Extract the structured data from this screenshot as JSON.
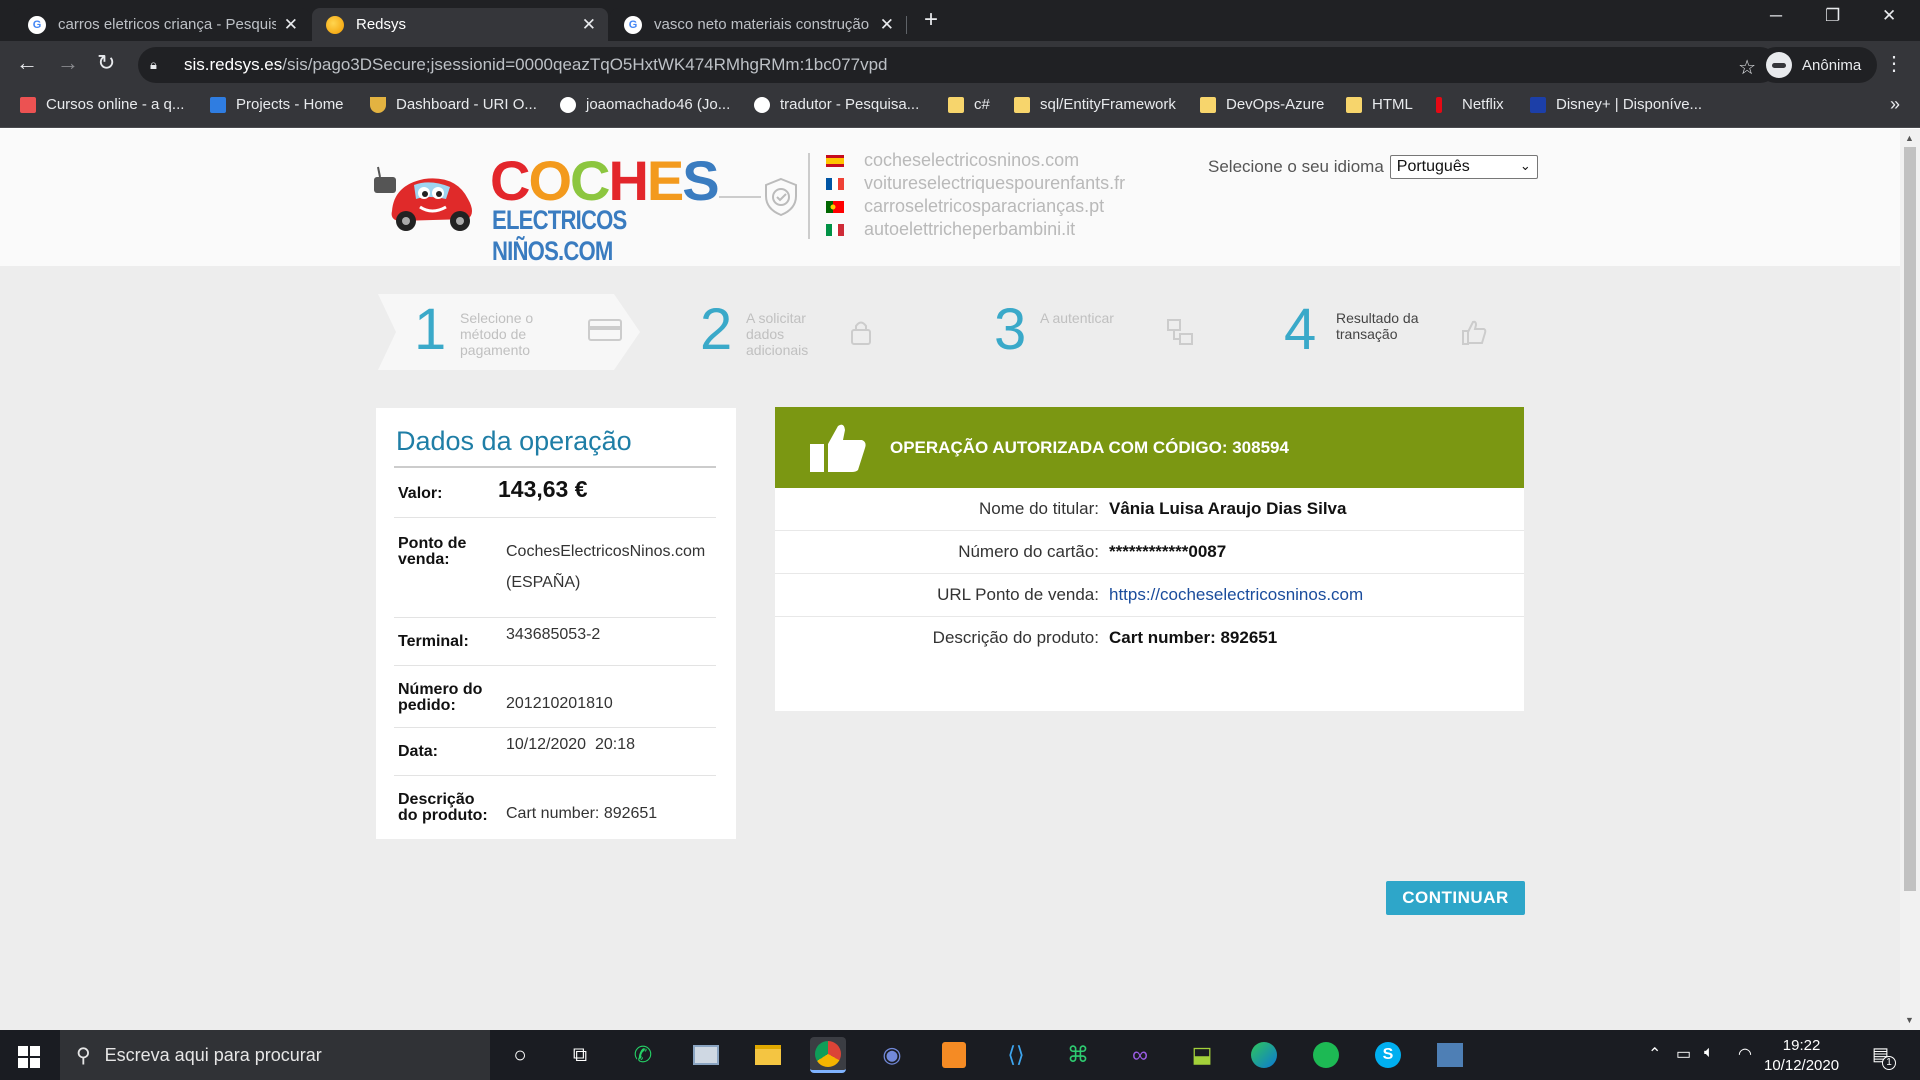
{
  "browser": {
    "tabs": [
      {
        "title": "carros eletricos criança - Pesquisa",
        "favicon": "google-icon",
        "active": false
      },
      {
        "title": "Redsys",
        "favicon": "redsys-icon",
        "active": true
      },
      {
        "title": "vasco neto materiais construção",
        "favicon": "google-icon",
        "active": false
      }
    ],
    "url_host": "sis.redsys.es",
    "url_path": "/sis/pago3DSecure;jsessionid=0000qeazTqO5HxtWK474RMhgRMm:1bc077vpd",
    "profile_label": "Anônima",
    "bookmarks": [
      {
        "label": "Cursos online - a q...",
        "icon": "udemy-icon"
      },
      {
        "label": "Projects - Home",
        "icon": "azure-devops-icon"
      },
      {
        "label": "Dashboard - URI O...",
        "icon": "trophy-icon"
      },
      {
        "label": "joaomachado46 (Jo...",
        "icon": "github-icon"
      },
      {
        "label": "tradutor - Pesquisa...",
        "icon": "google-icon"
      },
      {
        "label": "c#",
        "icon": "folder-icon"
      },
      {
        "label": "sql/EntityFramework",
        "icon": "folder-icon"
      },
      {
        "label": "DevOps-Azure",
        "icon": "folder-icon"
      },
      {
        "label": "HTML",
        "icon": "folder-icon"
      },
      {
        "label": "Netflix",
        "icon": "netflix-icon"
      },
      {
        "label": "Disney+ | Disponíve...",
        "icon": "disney-icon"
      }
    ]
  },
  "header": {
    "logo_line1": "COCHES",
    "logo_line2": "ELECTRICOS NIÑOS.COM",
    "domains": [
      {
        "text": "cocheselectricosninos.com",
        "flag": "es"
      },
      {
        "text": "voitureselectriquespourenfants.fr",
        "flag": "fr"
      },
      {
        "text": "carroseletricosparacrianças.pt",
        "flag": "pt"
      },
      {
        "text": "autoelettricheperbambini.it",
        "flag": "it"
      }
    ],
    "language_label": "Selecione o seu idioma",
    "language_value": "Português"
  },
  "steps": [
    {
      "number": "1",
      "label": "Selecione o método de pagamento",
      "icon": "credit-card-icon"
    },
    {
      "number": "2",
      "label": "A solicitar dados adicionais",
      "icon": "lock-icon"
    },
    {
      "number": "3",
      "label": "A autenticar",
      "icon": "transfer-icon"
    },
    {
      "number": "4",
      "label": "Resultado da transação",
      "icon": "thumbs-up-icon"
    }
  ],
  "operation": {
    "title": "Dados da operação",
    "amount_label": "Valor:",
    "amount": "143,63 €",
    "merchant_label": "Ponto de venda:",
    "merchant_name": "CochesElectricosNinos.com",
    "merchant_country": "(ESPAÑA)",
    "terminal_label": "Terminal:",
    "terminal": "343685053-2",
    "order_label": "Número do pedido:",
    "order": "201210201810",
    "date_label": "Data:",
    "date": "10/12/2020  20:18",
    "description_label": "Descrição do produto:",
    "description": "Cart number: 892651"
  },
  "result": {
    "message": "OPERAÇÃO AUTORIZADA COM CÓDIGO:  308594",
    "banner_color": "#7b9712",
    "rows": [
      {
        "label": "Nome do titular:",
        "value": "Vânia Luisa Araujo Dias Silva"
      },
      {
        "label": "Número do cartão:",
        "value": "************0087"
      },
      {
        "label": "URL Ponto de venda:",
        "value": "https://cocheselectricosninos.com"
      },
      {
        "label": "Descrição do produto:",
        "value": "Cart number: 892651"
      }
    ],
    "continue_label": "CONTINUAR",
    "accent": "#2ea6c9"
  },
  "taskbar": {
    "search_placeholder": "Escreva aqui para procurar",
    "time": "19:22",
    "date": "10/12/2020",
    "notification_count": "1"
  }
}
